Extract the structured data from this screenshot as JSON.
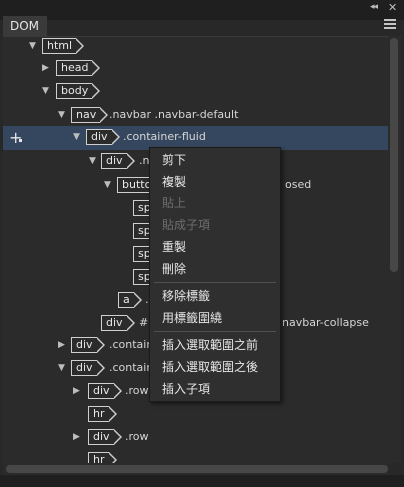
{
  "panel": {
    "tab_label": "DOM"
  },
  "tree": [
    {
      "tag": "html",
      "cls": "",
      "caret": "down"
    },
    {
      "tag": "head",
      "cls": "",
      "caret": "right"
    },
    {
      "tag": "body",
      "cls": "",
      "caret": "down"
    },
    {
      "tag": "nav",
      "cls": ".navbar .navbar-default",
      "caret": "down"
    },
    {
      "tag": "div",
      "cls": ".container-fluid",
      "caret": "down"
    },
    {
      "tag": "div",
      "cls": ".n",
      "caret": "down"
    },
    {
      "tag": "butto",
      "cls": "osed",
      "caret": "down"
    },
    {
      "tag": "sp",
      "cls": "",
      "caret": ""
    },
    {
      "tag": "sp",
      "cls": "",
      "caret": ""
    },
    {
      "tag": "sp",
      "cls": "",
      "caret": ""
    },
    {
      "tag": "sp",
      "cls": "",
      "caret": ""
    },
    {
      "tag": "a",
      "cls": ".",
      "caret": ""
    },
    {
      "tag": "div",
      "cls": "#",
      "cls2": "navbar-collapse",
      "caret": ""
    },
    {
      "tag": "div",
      "cls": ".contain",
      "caret": "right"
    },
    {
      "tag": "div",
      "cls": ".contain",
      "caret": "down"
    },
    {
      "tag": "div",
      "cls": ".row",
      "caret": "right"
    },
    {
      "tag": "hr",
      "cls": "",
      "caret": ""
    },
    {
      "tag": "div",
      "cls": ".row",
      "caret": "right"
    },
    {
      "tag": "hr",
      "cls": "",
      "caret": ""
    }
  ],
  "context_menu": {
    "items": [
      {
        "label": "剪下",
        "enabled": true
      },
      {
        "label": "複製",
        "enabled": true
      },
      {
        "label": "貼上",
        "enabled": false
      },
      {
        "label": "貼成子項",
        "enabled": false
      },
      {
        "label": "重製",
        "enabled": true
      },
      {
        "label": "刪除",
        "enabled": true
      },
      {
        "label": "移除標籤",
        "enabled": true
      },
      {
        "label": "用標籤圍繞",
        "enabled": true
      },
      {
        "label": "插入選取範圍之前",
        "enabled": true
      },
      {
        "label": "插入選取範圍之後",
        "enabled": true
      },
      {
        "label": "插入子項",
        "enabled": true
      }
    ]
  },
  "icons": {
    "collapse": "double-chevron-icon",
    "close": "close-icon",
    "panel_menu": "hamburger-menu-icon",
    "add_element": "plus-icon"
  },
  "colors": {
    "selection": "#35475e",
    "background": "#2b2b2b"
  }
}
